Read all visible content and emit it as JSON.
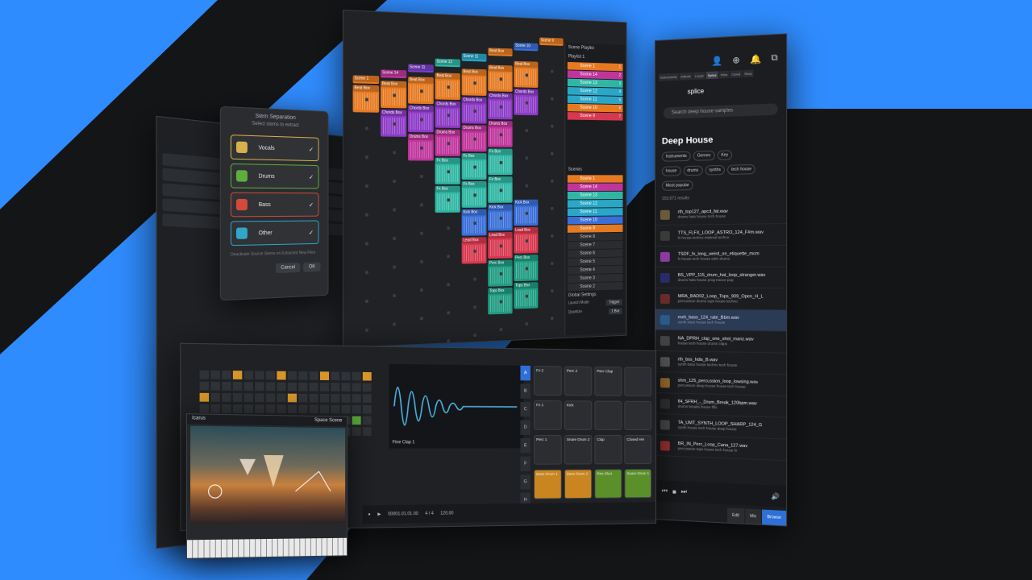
{
  "colors": {
    "accent": "#2f8cff",
    "dark_band": "#141517"
  },
  "stem_dialog": {
    "title": "Stem Separation",
    "subtitle": "Select stems to extract",
    "stems": [
      {
        "label": "Vocals",
        "color": "#d8b04a"
      },
      {
        "label": "Drums",
        "color": "#5fae3c"
      },
      {
        "label": "Bass",
        "color": "#d44a3a"
      },
      {
        "label": "Other",
        "color": "#2fa7c9"
      }
    ],
    "check": "✓",
    "hint": "Deactivate Source Stems on Extracted New Files",
    "cancel": "Cancel",
    "ok": "OK"
  },
  "launcher": {
    "header_scenes": [
      {
        "label": "Scene 1",
        "color": "#e67a22"
      },
      {
        "label": "Scene 14",
        "color": "#c0359c"
      },
      {
        "label": "Scene 11",
        "color": "#7a3fc7"
      },
      {
        "label": "Scene 12",
        "color": "#2fb6a4"
      },
      {
        "label": "Scene 11",
        "color": "#2aa7c8"
      },
      {
        "label": "Beat Box",
        "color": "#e67a22"
      },
      {
        "label": "Scene 10",
        "color": "#3a6fd8"
      },
      {
        "label": "Scene 9",
        "color": "#e67a22"
      }
    ],
    "clips": [
      {
        "label": "Scene 1",
        "color": "#e67a22"
      },
      {
        "label": "Beat Box",
        "color": "#e67a22"
      },
      {
        "label": "Chords Box",
        "color": "#8d3bc7"
      },
      {
        "label": "Drums Box",
        "color": "#c0359c"
      },
      {
        "label": "Fx Box",
        "color": "#2fb6a4"
      },
      {
        "label": "Kick Box",
        "color": "#3a6fd8"
      },
      {
        "label": "Lead Box",
        "color": "#d8384f"
      },
      {
        "label": "Perc Box",
        "color": "#1f9c82"
      },
      {
        "label": "Tops Box",
        "color": "#1f9c82"
      },
      {
        "label": "Fx Box",
        "color": "#2aa7c8"
      }
    ],
    "playlist_title": "Scene Playlist",
    "playlist_name": "Playlist 1",
    "playlist": [
      {
        "label": "Scene 1",
        "num": "1",
        "color": "#e67a22"
      },
      {
        "label": "Scene 14",
        "num": "2",
        "color": "#c0359c"
      },
      {
        "label": "Scene 13",
        "num": "3",
        "color": "#2fb6a4"
      },
      {
        "label": "Scene 12",
        "num": "4",
        "color": "#2aa7c8"
      },
      {
        "label": "Scene 11",
        "num": "5",
        "color": "#2aa7c8"
      },
      {
        "label": "Scene 10",
        "num": "6",
        "color": "#e67a22"
      },
      {
        "label": "Scene 9",
        "num": "7",
        "color": "#d8384f"
      }
    ],
    "scenes_title": "Scenes",
    "scenes": [
      {
        "label": "Scene 1",
        "color": "#e67a22"
      },
      {
        "label": "Scene 14",
        "color": "#c0359c"
      },
      {
        "label": "Scene 13",
        "color": "#2fb6a4"
      },
      {
        "label": "Scene 12",
        "color": "#2aa7c8"
      },
      {
        "label": "Scene 11",
        "color": "#2aa7c8"
      },
      {
        "label": "Scene 10",
        "color": "#3a6fd8"
      },
      {
        "label": "Scene 9",
        "color": "#e67a22"
      },
      {
        "label": "Scene 8",
        "color": ""
      },
      {
        "label": "Scene 7",
        "color": ""
      },
      {
        "label": "Scene 6",
        "color": ""
      },
      {
        "label": "Scene 5",
        "color": ""
      },
      {
        "label": "Scene 4",
        "color": ""
      },
      {
        "label": "Scene 3",
        "color": ""
      },
      {
        "label": "Scene 2",
        "color": ""
      }
    ],
    "global_title": "Global Settings",
    "launch_mode_label": "Launch Mode",
    "launch_mode_value": "Trigger",
    "quantize_label": "Quantize",
    "quantize_value": "1 Bar"
  },
  "splice": {
    "tabs": [
      "Instruments",
      "Effects",
      "Loops",
      "Splice",
      "Files",
      "Cloud",
      "Shop"
    ],
    "active_tab": "Splice",
    "logo": "splice",
    "search_placeholder": "Search deep house samples",
    "heading": "Deep House",
    "filters": [
      "Instruments",
      "Genres",
      "Key"
    ],
    "tags": [
      "house",
      "drums",
      "synths",
      "tech house"
    ],
    "sort": "Most popular",
    "results": "153,671 results",
    "samples": [
      {
        "name": "rth_top127_apcd_fat.wav",
        "tags": "drums  hats  house  tech house"
      },
      {
        "name": "TTS_FLFX_LOOP_ASTRO_124_F#m.wav",
        "tags": "fx  house  techno  minimal techno"
      },
      {
        "name": "TSDF_fx_long_weird_on_etiquette_mcm",
        "tags": "fx  house  tech house  edm  drums"
      },
      {
        "name": "BS_VPP_115_drum_hat_loop_stranger.wav",
        "tags": "drums  hats  house  prog trance  pop"
      },
      {
        "name": "MRA_BAD02_Loop_Tops_909_Open_H_L",
        "tags": "percussion  drums  tops  house  techno"
      },
      {
        "name": "mxh_bass_124_rate_Bbm.wav",
        "tags": "synth  bass  house  tech house"
      },
      {
        "name": "NA_DPRH_clap_one_shot_manz.wav",
        "tags": "house  tech house  drums  claps"
      },
      {
        "name": "rth_bss_hdis_B.wav",
        "tags": "synth  bass  house  techno  tech house"
      },
      {
        "name": "shm_125_percussion_loop_lowsing.wav",
        "tags": "percussion  deep house  house  tech house"
      },
      {
        "name": "fl4_SFRH_-_Drum_Break_120bpm.wav",
        "tags": "drums  breaks  house  fills"
      },
      {
        "name": "TA_UMT_SYNTH_LOOP_SHARP_124_G",
        "tags": "synth  house  tech house  deep house"
      },
      {
        "name": "BR_IN_Perc_Loop_Cana_127.wav",
        "tags": "percussion  tops  house  tech house  fx"
      }
    ],
    "modes": [
      "Edit",
      "Mix",
      "Browse"
    ],
    "active_mode": "Browse"
  },
  "editor": {
    "banks": [
      "A",
      "B",
      "C",
      "D",
      "E",
      "F",
      "G",
      "H"
    ],
    "active_bank": "A",
    "pads": [
      {
        "label": "Fx 2",
        "color": "#2b2d31"
      },
      {
        "label": "Perc 2",
        "color": "#2b2d31"
      },
      {
        "label": "Perc Clap",
        "color": "#2b2d31"
      },
      {
        "label": "",
        "color": "#2b2d31"
      },
      {
        "label": "Fx 1",
        "color": "#2b2d31"
      },
      {
        "label": "Kick",
        "color": "#2b2d31"
      },
      {
        "label": "",
        "color": "#2b2d31"
      },
      {
        "label": "",
        "color": "#2b2d31"
      },
      {
        "label": "Perc 1",
        "color": "#2b2d31"
      },
      {
        "label": "Snare Drum 2",
        "color": "#2b2d31"
      },
      {
        "label": "Clap",
        "color": "#2b2d31"
      },
      {
        "label": "Closed HH",
        "color": "#2b2d31"
      },
      {
        "label": "Bass Drum 1",
        "color": "#c9851f"
      },
      {
        "label": "Bass Drum 2",
        "color": "#c9851f"
      },
      {
        "label": "Rim Shot",
        "color": "#5a8f2a"
      },
      {
        "label": "Snare Drum 1",
        "color": "#5a8f2a"
      }
    ],
    "sample_name": "Fine Clap 1",
    "tempo": "120.00",
    "signature": "4 / 4",
    "position": "00001.01.01.00"
  },
  "synth": {
    "title": "Icarus",
    "preset": "Space Scene"
  }
}
